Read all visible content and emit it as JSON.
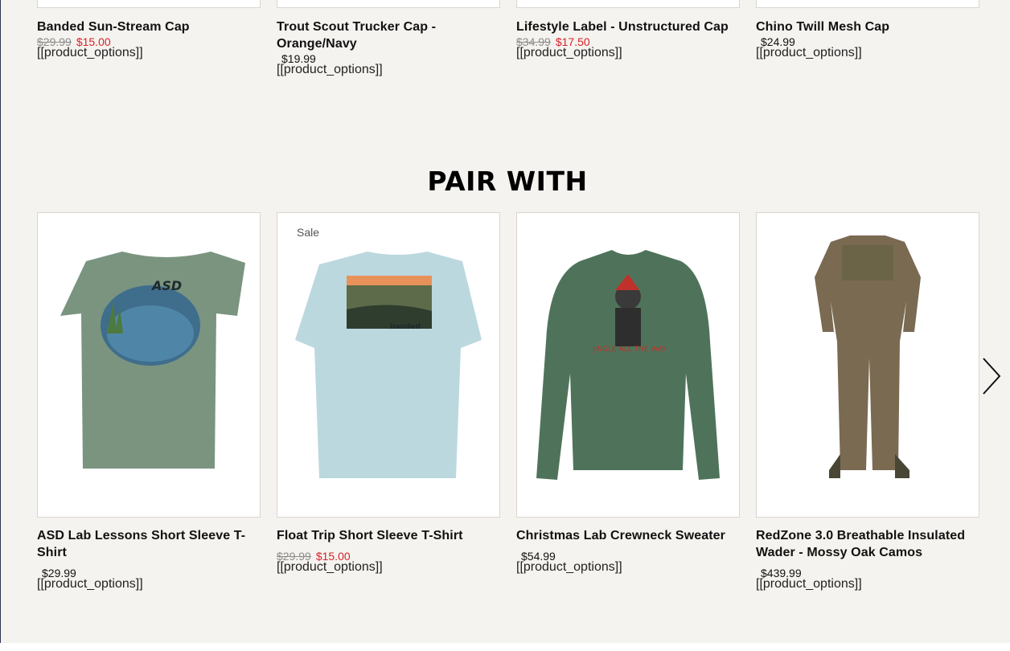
{
  "top_products": [
    {
      "name": "Banded Sun-Stream Cap",
      "price_was": "$29.99",
      "price_now": "$15.00",
      "price": "",
      "options": "[[product_options]]"
    },
    {
      "name": "Trout Scout Trucker Cap - Orange/Navy",
      "price_was": "",
      "price_now": "",
      "price": "$19.99",
      "options": "[[product_options]]"
    },
    {
      "name": "Lifestyle Label - Unstructured Cap",
      "price_was": "$34.99",
      "price_now": "$17.50",
      "price": "",
      "options": "[[product_options]]"
    },
    {
      "name": "Chino Twill Mesh Cap",
      "price_was": "",
      "price_now": "",
      "price": "$24.99",
      "options": "[[product_options]]"
    }
  ],
  "pair_with": {
    "title": "PAIR WITH",
    "sale_label": "Sale",
    "products": [
      {
        "name": "ASD Lab Lessons Short Sleeve T-Shirt",
        "price_was": "",
        "price_now": "",
        "price": "$29.99",
        "options": "[[product_options]]"
      },
      {
        "name": "Float Trip Short Sleeve T-Shirt",
        "price_was": "$29.99",
        "price_now": "$15.00",
        "price": "",
        "options": "[[product_options]]"
      },
      {
        "name": "Christmas Lab Crewneck Sweater",
        "price_was": "",
        "price_now": "",
        "price": "$54.99",
        "options": "[[product_options]]"
      },
      {
        "name": "RedZone 3.0 Breathable Insulated Wader - Mossy Oak Camos",
        "price_was": "",
        "price_now": "",
        "price": "$439.99",
        "options": "[[product_options]]"
      }
    ]
  },
  "icons": {
    "next": "chevron-right-icon"
  },
  "colors": {
    "sale_price": "#d4232a",
    "background": "#f5f3ef",
    "tee_green": "#7a9480",
    "tee_blue": "#bcd8df",
    "sweater": "#4f735a"
  }
}
